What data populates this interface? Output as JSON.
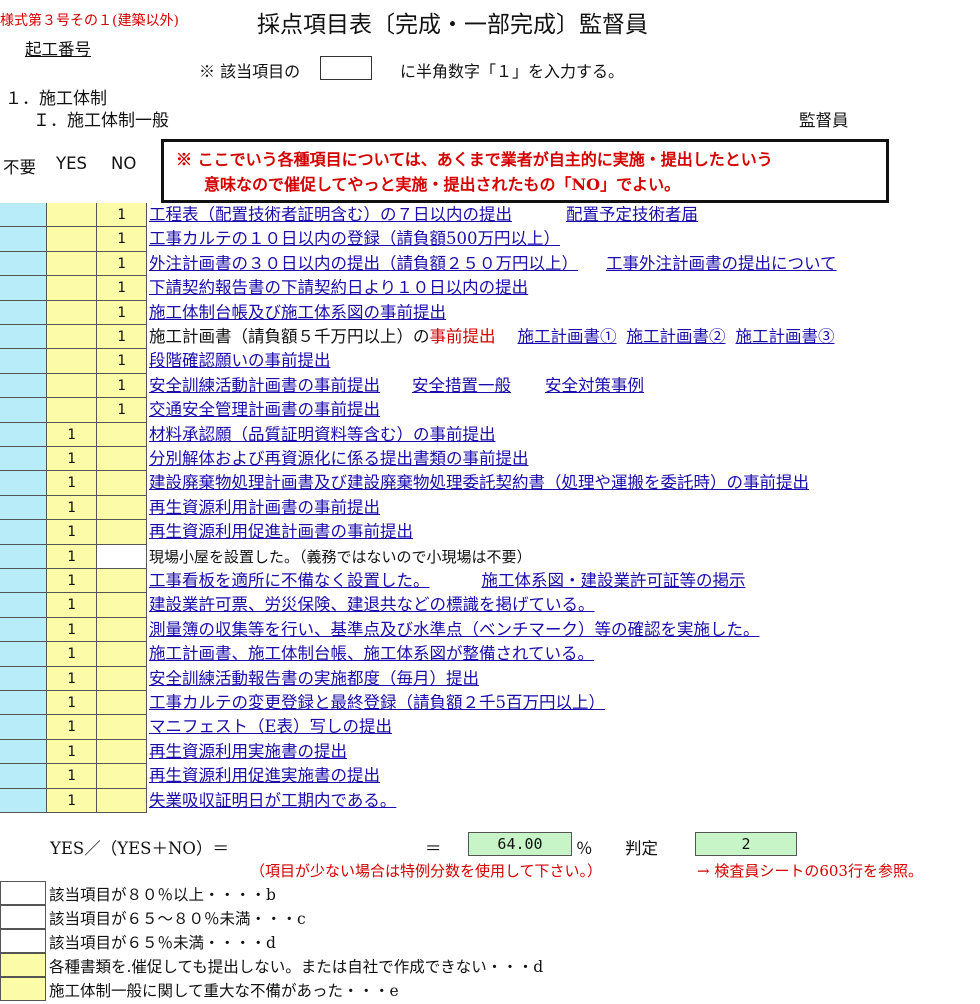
{
  "header": {
    "form_label": "様式第３号その１(建築以外)",
    "title": "採点項目表〔完成・一部完成〕監督員",
    "kiko": "起工番号",
    "instruction_pre": "※ 該当項目の",
    "instruction_post": "に半角数字「１」を入力する。",
    "section": "１．施工体制",
    "subsection": "Ｉ．施工体制一般",
    "role": "監督員"
  },
  "columns": {
    "fuyo": "不要",
    "yes": "YES",
    "no": "NO"
  },
  "note": {
    "line1": "※ ここでいう各種項目については、あくまで業者が自主的に実施・提出したという",
    "line2": "意味なので催促してやっと実施・提出されたもの「NO」でよい。"
  },
  "rows": [
    {
      "yes": "",
      "no": "1",
      "segments": [
        {
          "t": "工程表（配置技術者証明含む）の７日以内の提出",
          "link": true
        },
        {
          "gap": 54
        },
        {
          "t": "配置予定技術者届",
          "link": true
        }
      ]
    },
    {
      "yes": "",
      "no": "1",
      "segments": [
        {
          "t": "工事カルテの１０日以内の登録（請負額500万円以上）",
          "link": true
        }
      ]
    },
    {
      "yes": "",
      "no": "1",
      "segments": [
        {
          "t": "外注計画書の３０日以内の提出（請負額２５０万円以上）",
          "link": true
        },
        {
          "gap": 28
        },
        {
          "t": "工事外注計画書の提出について",
          "link": true
        }
      ]
    },
    {
      "yes": "",
      "no": "1",
      "segments": [
        {
          "t": "下請契約報告書の下請契約日より１０日以内の提出",
          "link": true
        }
      ]
    },
    {
      "yes": "",
      "no": "1",
      "segments": [
        {
          "t": "施工体制台帳及び施工体系図の事前提出",
          "link": true
        }
      ]
    },
    {
      "yes": "",
      "no": "1",
      "segments": [
        {
          "t": "施工計画書（請負額５千万円以上）の",
          "link": false
        },
        {
          "t": "事前提出",
          "red": true
        },
        {
          "gap": 22
        },
        {
          "t": "施工計画書①",
          "link": true
        },
        {
          "gap": 10
        },
        {
          "t": "施工計画書②",
          "link": true
        },
        {
          "gap": 10
        },
        {
          "t": "施工計画書③",
          "link": true
        }
      ]
    },
    {
      "yes": "",
      "no": "1",
      "segments": [
        {
          "t": "段階確認願いの事前提出",
          "link": true
        }
      ]
    },
    {
      "yes": "",
      "no": "1",
      "segments": [
        {
          "t": "安全訓練活動計画書の事前提出",
          "link": true
        },
        {
          "gap": 32
        },
        {
          "t": "安全措置一般",
          "link": true
        },
        {
          "gap": 34
        },
        {
          "t": "安全対策事例",
          "link": true
        }
      ]
    },
    {
      "yes": "",
      "no": "1",
      "segments": [
        {
          "t": "交通安全管理計画書の事前提出",
          "link": true
        }
      ]
    },
    {
      "yes": "1",
      "no": "",
      "segments": [
        {
          "t": "材料承認願（品質証明資料等含む）の事前提出",
          "link": true
        }
      ]
    },
    {
      "yes": "1",
      "no": "",
      "segments": [
        {
          "t": "分別解体および再資源化に係る提出書類の事前提出",
          "link": true
        }
      ]
    },
    {
      "yes": "1",
      "no": "",
      "segments": [
        {
          "t": "建設廃棄物処理計画書及び建設廃棄物処理委託契約書（処理や運搬を委託時）の事前提出",
          "link": true
        }
      ]
    },
    {
      "yes": "1",
      "no": "",
      "segments": [
        {
          "t": "再生資源利用計画書の事前提出",
          "link": true
        }
      ]
    },
    {
      "yes": "1",
      "no": "",
      "segments": [
        {
          "t": "再生資源利用促進計画書の事前提出",
          "link": true
        }
      ]
    },
    {
      "yes": "1",
      "no": "",
      "white": true,
      "segments": [
        {
          "t": "現場小屋を設置した。（義務ではないので小現場は不要）",
          "link": false,
          "small": true
        }
      ]
    },
    {
      "yes": "1",
      "no": "",
      "segments": [
        {
          "t": "工事看板を適所に不備なく設置した。",
          "link": true
        },
        {
          "gap": 52
        },
        {
          "t": "施工体系図・建設業許可証等の掲示",
          "link": true
        }
      ]
    },
    {
      "yes": "1",
      "no": "",
      "segments": [
        {
          "t": "建設業許可票、労災保険、建退共などの標識を掲げている。",
          "link": true
        }
      ]
    },
    {
      "yes": "1",
      "no": "",
      "segments": [
        {
          "t": "測量簿の収集等を行い、基準点及び水準点（ベンチマーク）等の確認を実施した。",
          "link": true
        }
      ]
    },
    {
      "yes": "1",
      "no": "",
      "segments": [
        {
          "t": "施工計画書、施工体制台帳、施工体系図が整備されている。",
          "link": true
        }
      ]
    },
    {
      "yes": "1",
      "no": "",
      "segments": [
        {
          "t": "安全訓練活動報告書の実施都度（毎月）提出",
          "link": true
        }
      ]
    },
    {
      "yes": "1",
      "no": "",
      "segments": [
        {
          "t": "工事カルテの変更登録と最終登録（請負額２千5百万円以上）",
          "link": true
        }
      ]
    },
    {
      "yes": "1",
      "no": "",
      "segments": [
        {
          "t": "マニフェスト（E表）写しの提出",
          "link": true
        }
      ]
    },
    {
      "yes": "1",
      "no": "",
      "segments": [
        {
          "t": "再生資源利用実施書の提出",
          "link": true
        }
      ]
    },
    {
      "yes": "1",
      "no": "",
      "segments": [
        {
          "t": "再生資源利用促進実施書の提出",
          "link": true
        }
      ]
    },
    {
      "yes": "1",
      "no": "",
      "segments": [
        {
          "t": "失業吸収証明日が工期内である。",
          "link": true
        }
      ]
    }
  ],
  "score": {
    "formula": "YES／（YES＋NO）＝",
    "equals": "＝",
    "value": "64.00",
    "percent": "％",
    "judge_label": "判定",
    "judge_value": "2",
    "note_left": "（項目が少ない場合は特例分数を使用して下さい。）",
    "note_right": "→ 検査員シートの603行を参照。"
  },
  "criteria": [
    {
      "text": "該当項目が８０％以上・・・・b",
      "yellow": false
    },
    {
      "text": "該当項目が６５～８０％未満・・・c",
      "yellow": false
    },
    {
      "text": "該当項目が６５％未満・・・・d",
      "yellow": false
    },
    {
      "text": "各種書類を.催促しても提出しない。または自社で作成できない・・・d",
      "yellow": true
    },
    {
      "text": "施工体制一般に関して重大な不備があった・・・e",
      "yellow": true
    }
  ],
  "colors": {
    "blue": "#b7ecf8",
    "yellow": "#fbfba8",
    "green": "#c8f5c8",
    "red": "#d40000",
    "link": "#1a0dab"
  }
}
